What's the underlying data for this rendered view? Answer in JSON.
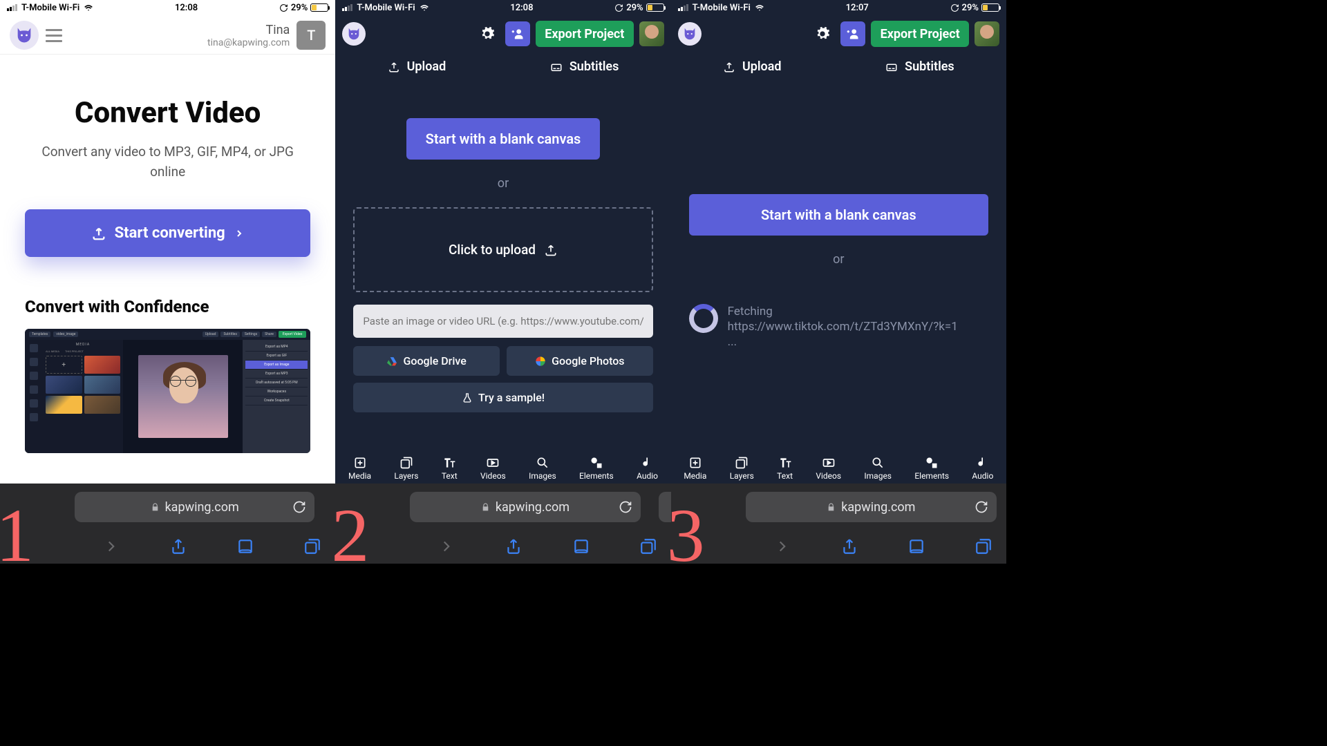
{
  "status": {
    "carrier": "T-Mobile Wi-Fi",
    "time12": "12:08",
    "time3": "12:07",
    "battery": "29%"
  },
  "phone1": {
    "user": {
      "name": "Tina",
      "email": "tina@kapwing.com",
      "initial": "T"
    },
    "title": "Convert Video",
    "subtitle": "Convert any video to MP3, GIF, MP4, or JPG online",
    "cta": "Start converting",
    "section_title": "Convert with Confidence",
    "ss": {
      "breadcrumb1": "Templates",
      "breadcrumb2": "video_image",
      "upload": "Upload",
      "subtitles": "Subtitles",
      "settings": "Settings",
      "share": "Share",
      "export": "Export Video",
      "media_head": "MEDIA",
      "tab_all": "ALL MEDIA",
      "tab_proj": "THIS PROJECT",
      "add_media": "+",
      "menu": [
        "Export as MP4",
        "Export as GIF",
        "Export as Image",
        "Export as MP3",
        "Draft autosaved at 5:05 PM",
        "Workspaces",
        "Create Snapshot"
      ]
    }
  },
  "app": {
    "export_label": "Export Project",
    "upload_label": "Upload",
    "subtitles_label": "Subtitles",
    "blank_canvas": "Start with a blank canvas",
    "or": "or",
    "click_upload": "Click to upload",
    "url_placeholder": "Paste an image or video URL (e.g. https://www.youtube.com/watch?v=...)",
    "gdrive": "Google Drive",
    "gphotos": "Google Photos",
    "try_sample": "Try a sample!",
    "fetching": "Fetching",
    "fetching_url": "https://www.tiktok.com/t/ZTd3YMXnY/?k=1",
    "ellipsis": "...",
    "toolbar": [
      "Media",
      "Layers",
      "Text",
      "Videos",
      "Images",
      "Elements",
      "Audio"
    ]
  },
  "browser": {
    "domain": "kapwing.com"
  },
  "numbers": {
    "n1": "1",
    "n2": "2",
    "n3": "3"
  }
}
